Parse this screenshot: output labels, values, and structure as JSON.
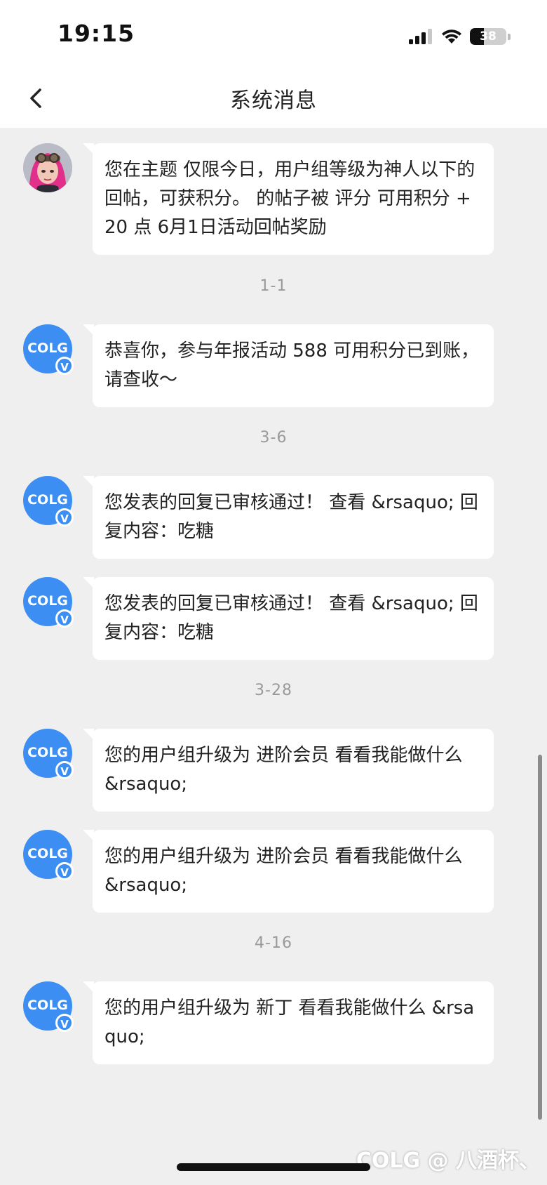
{
  "status_bar": {
    "time": "19:15",
    "battery": "38"
  },
  "header": {
    "title": "系统消息"
  },
  "messages": [
    {
      "text": "您在主题   仅限今日，用户组等级为神人以下的回帖，可获积分。 的帖子被  评分 可用积分 +20 点 6月1日活动回帖奖励"
    },
    {
      "date": "1-1",
      "text": "恭喜你，参与年报活动 588 可用积分已到账，请查收～"
    },
    {
      "date": "3-6",
      "text": "您发表的回复已审核通过！   查看 &rsaquo; 回复内容：吃糖"
    },
    {
      "text": "您发表的回复已审核通过！   查看 &rsaquo; 回复内容：吃糖"
    },
    {
      "date": "3-28",
      "text": "您的用户组升级为  进阶会员   看看我能做什么 &rsaquo;"
    },
    {
      "text": "您的用户组升级为  进阶会员   看看我能做什么 &rsaquo;"
    },
    {
      "date": "4-16",
      "text": "您的用户组升级为   新丁       看看我能做什么 &rsaquo;"
    }
  ],
  "avatar_logo": "COLG",
  "avatar_badge": "V",
  "watermark": "COLG @ 八酒杯、"
}
